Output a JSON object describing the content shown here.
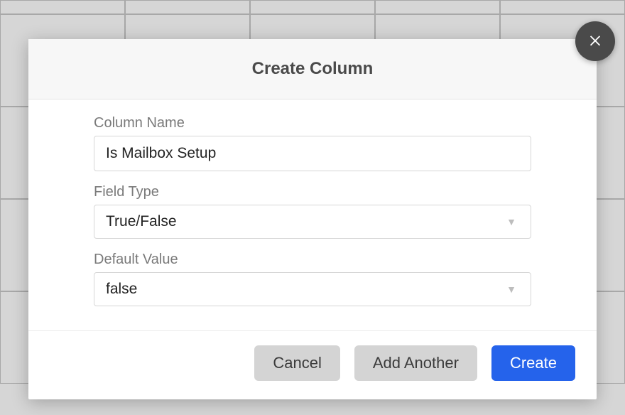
{
  "modal": {
    "title": "Create Column",
    "fields": {
      "column_name": {
        "label": "Column Name",
        "value": "Is Mailbox Setup"
      },
      "field_type": {
        "label": "Field Type",
        "value": "True/False"
      },
      "default_value": {
        "label": "Default Value",
        "value": "false"
      }
    },
    "buttons": {
      "cancel": "Cancel",
      "add_another": "Add Another",
      "create": "Create"
    }
  }
}
